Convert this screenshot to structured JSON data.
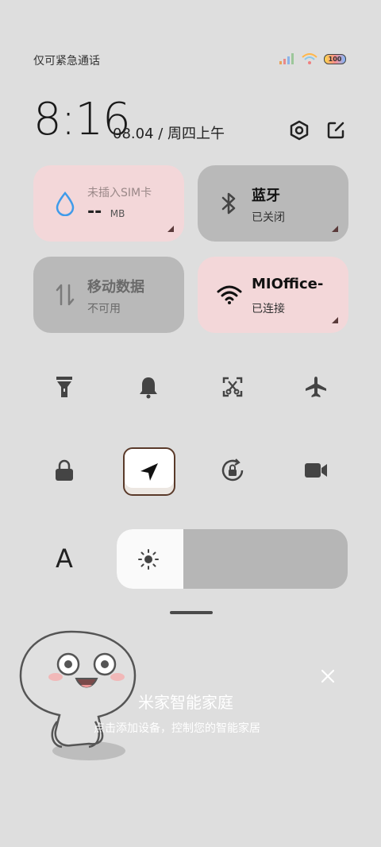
{
  "status_bar": {
    "carrier_text": "仅可紧急通话",
    "signal_icon": "signal-icon",
    "wifi_icon": "wifi-icon",
    "battery_text": "100"
  },
  "header": {
    "time": "8:16",
    "date": "08.04 / 周四上午",
    "settings_icon": "gear-icon",
    "edit_icon": "edit-icon"
  },
  "tiles": {
    "data_usage": {
      "title": "未插入SIM卡",
      "value": "--",
      "unit": "MB",
      "icon": "water-drop-icon"
    },
    "bluetooth": {
      "title": "蓝牙",
      "status": "已关闭",
      "icon": "bluetooth-icon"
    },
    "mobile_data": {
      "title": "移动数据",
      "status": "不可用",
      "icon": "mobile-data-icon"
    },
    "wifi": {
      "title": "MIOffice-",
      "status": "已连接",
      "icon": "wifi-icon"
    }
  },
  "toggles_row1": [
    "flashlight-icon",
    "bell-icon",
    "screenshot-icon",
    "airplane-icon"
  ],
  "toggles_row2": [
    "lock-icon",
    "location-icon",
    "rotation-lock-icon",
    "video-camera-icon"
  ],
  "brightness": {
    "auto_label": "A",
    "level": 0.29
  },
  "mijia": {
    "title": "米家智能家庭",
    "subtitle": "点击添加设备，控制您的智能家居"
  },
  "colors": {
    "background": "#dedede",
    "tile_active": "#f3d7d9",
    "tile_inactive": "#b9b9b9",
    "wifi_icon_tile": "#111111",
    "drop_icon": "#3f9bea"
  }
}
